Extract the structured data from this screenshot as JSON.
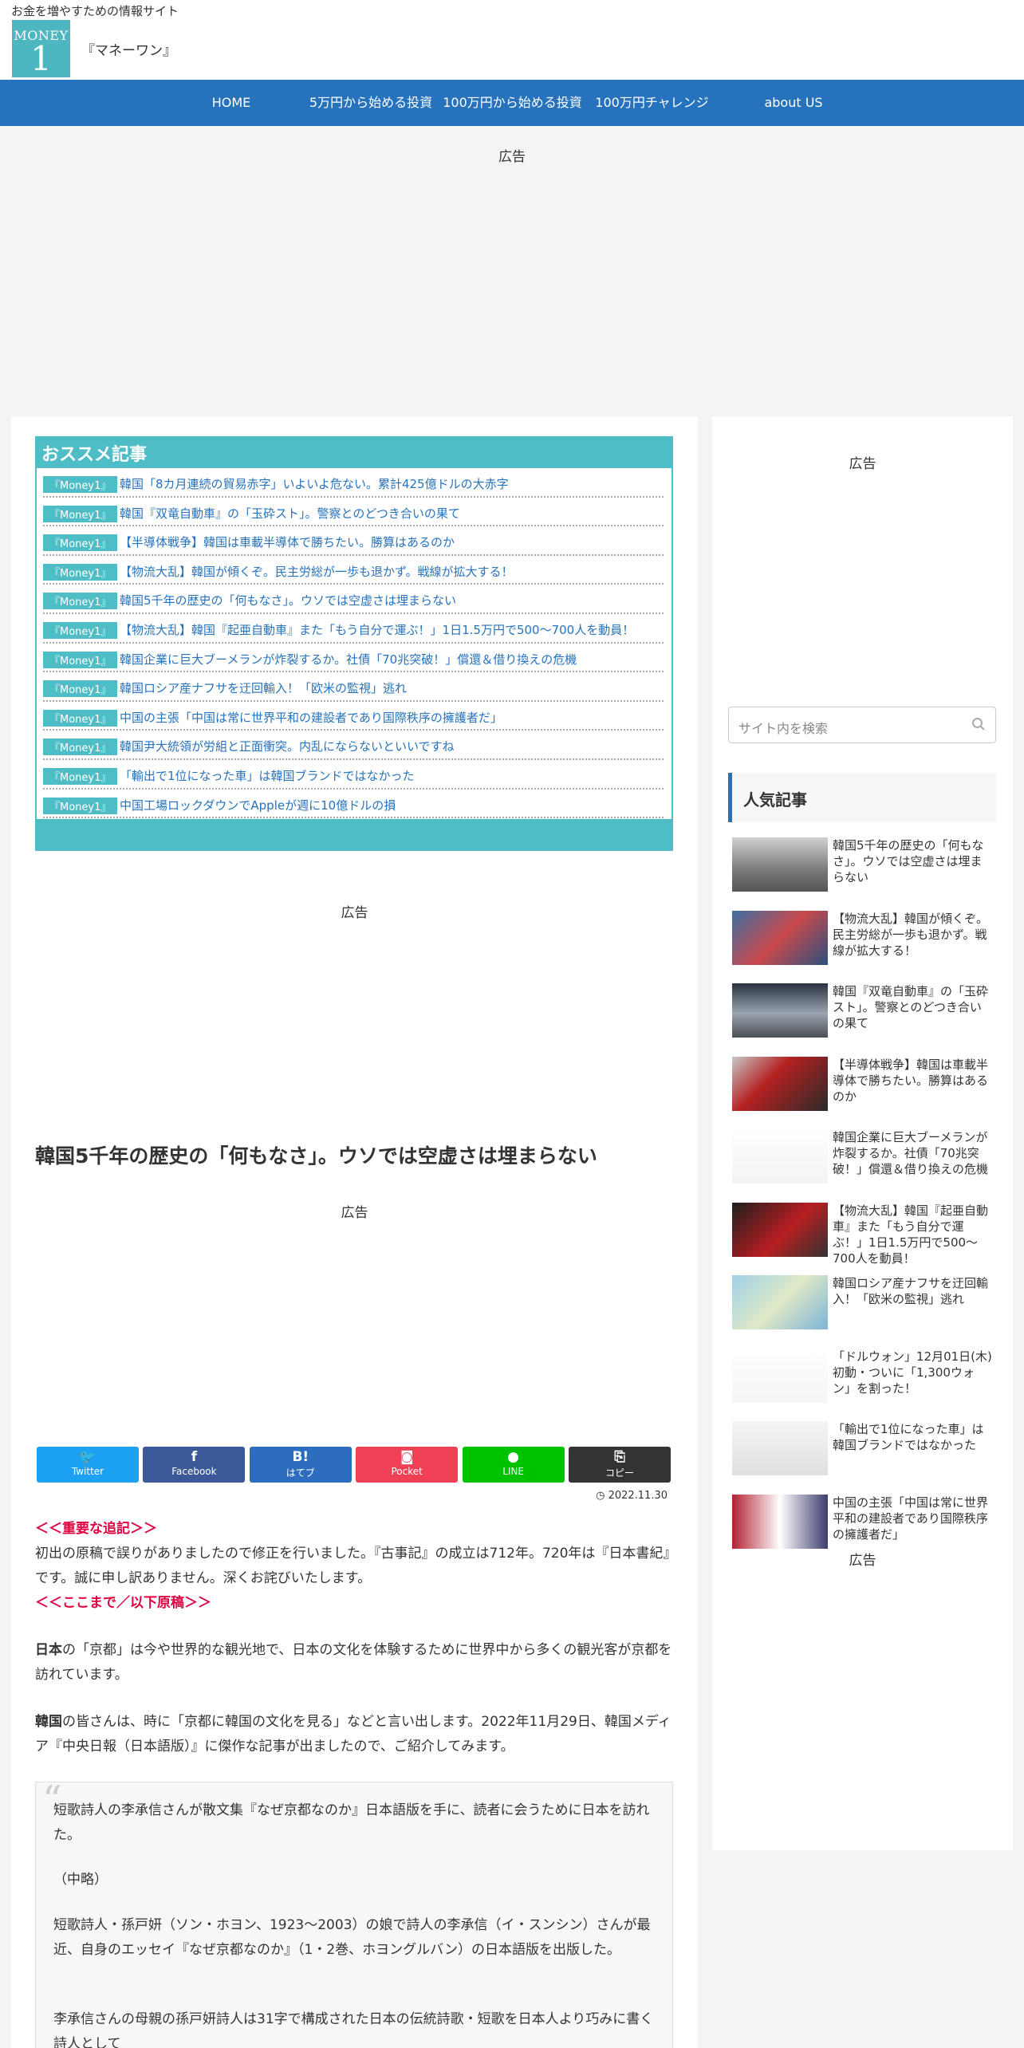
{
  "header": {
    "tagline": "お金を増やすための情報サイト",
    "logo_top": "MONEY",
    "logo_num": "1",
    "site_name": "『マネーワン』"
  },
  "nav": {
    "items": [
      "HOME",
      "5万円から始める投資",
      "100万円から始める投資",
      "100万円チャレンジ",
      "about US"
    ]
  },
  "ads": {
    "label": "広告"
  },
  "recommend": {
    "title": "おススメ記事",
    "tag": "『Money1』",
    "items": [
      "韓国「8カ月連続の貿易赤字」いよいよ危ない。累計425億ドルの大赤字",
      "韓国『双竜自動車』の「玉砕スト」。警察とのどつき合いの果て",
      "【半導体戦争】韓国は車載半導体で勝ちたい。勝算はあるのか",
      "【物流大乱】韓国が傾くぞ。民主労総が一歩も退かず。戦線が拡大する！",
      "韓国5千年の歴史の「何もなさ」。ウソでは空虚さは埋まらない",
      "【物流大乱】韓国『起亜自動車』また「もう自分で運ぶ！」1日1.5万円で500～700人を動員！",
      "韓国企業に巨大ブーメランが炸裂するか。社債「70兆突破！」償還＆借り換えの危機",
      "韓国ロシア産ナフサを迂回輸入！「欧米の監視」逃れ",
      "中国の主張「中国は常に世界平和の建設者であり国際秩序の擁護者だ」",
      "韓国尹大統領が労組と正面衝突。内乱にならないといいですね",
      "「輸出で1位になった車」は韓国ブランドではなかった",
      "中国工場ロックダウンでAppleが週に10億ドルの損"
    ]
  },
  "article": {
    "title": "韓国5千年の歴史の「何もなさ」。ウソでは空虚さは埋まらない",
    "date": "2022.11.30",
    "notice_head": "＜＜重要な追記＞＞",
    "notice_body": "初出の原稿で誤りがありましたので修正を行いました。『古事記』の成立は712年。720年は『日本書紀』です。誠に申し訳ありません。深くお詫びいたします。",
    "notice_tail": "＜＜ここまで／以下原稿＞＞",
    "p1_bold": "日本",
    "p1_rest": "の「京都」は今や世界的な観光地で、日本の文化を体験するために世界中から多くの観光客が京都を訪れています。",
    "p2_bold": "韓国",
    "p2_rest": "の皆さんは、時に「京都に韓国の文化を見る」などと言い出します。2022年11月29日、韓国メディア『中央日報（日本語版）』に傑作な記事が出ましたので、ご紹介してみます。",
    "quote": {
      "q1": "短歌詩人の李承信さんが散文集『なぜ京都なのか』日本語版を手に、読者に会うために日本を訪れた。",
      "q2": "（中略）",
      "q3": "短歌詩人・孫戸妍（ソン・ホヨン、1923～2003）の娘で詩人の李承信（イ・スンシン）さんが最近、自身のエッセイ『なぜ京都なのか』（1・2巻、ホヨングルバン）の日本語版を出版した。",
      "q4": "李承信さんの母親の孫戸妍詩人は31字で構成された日本の伝統詩歌・短歌を日本人より巧みに書く詩人として"
    }
  },
  "share": {
    "buttons": [
      {
        "icon": "🐦",
        "label": "Twitter",
        "color": "#1da1f2"
      },
      {
        "icon": "f",
        "label": "Facebook",
        "color": "#3b5998"
      },
      {
        "icon": "B!",
        "label": "はてブ",
        "color": "#2c6ebd"
      },
      {
        "icon": "◙",
        "label": "Pocket",
        "color": "#ef4056"
      },
      {
        "icon": "●",
        "label": "LINE",
        "color": "#00c300"
      },
      {
        "icon": "⎘",
        "label": "コピー",
        "color": "#333333"
      }
    ]
  },
  "sidebar": {
    "search_placeholder": "サイト内を検索",
    "popular_title": "人気記事",
    "popular": [
      "韓国5千年の歴史の「何もなさ」。ウソでは空虚さは埋まらない",
      "【物流大乱】韓国が傾くぞ。民主労総が一歩も退かず。戦線が拡大する！",
      "韓国『双竜自動車』の「玉砕スト」。警察とのどつき合いの果て",
      "【半導体戦争】韓国は車載半導体で勝ちたい。勝算はあるのか",
      "韓国企業に巨大ブーメランが炸裂するか。社債「70兆突破！」償還＆借り換えの危機",
      "【物流大乱】韓国『起亜自動車』また「もう自分で運ぶ！」1日1.5万円で500～700人を動員！",
      "韓国ロシア産ナフサを迂回輸入！「欧米の監視」逃れ",
      "「ドルウォン」12月01日(木)初動・ついに「1,300ウォン」を割った！",
      "「輸出で1位になった車」は韓国ブランドではなかった",
      "中国の主張「中国は常に世界平和の建設者であり国際秩序の擁護者だ」"
    ]
  }
}
